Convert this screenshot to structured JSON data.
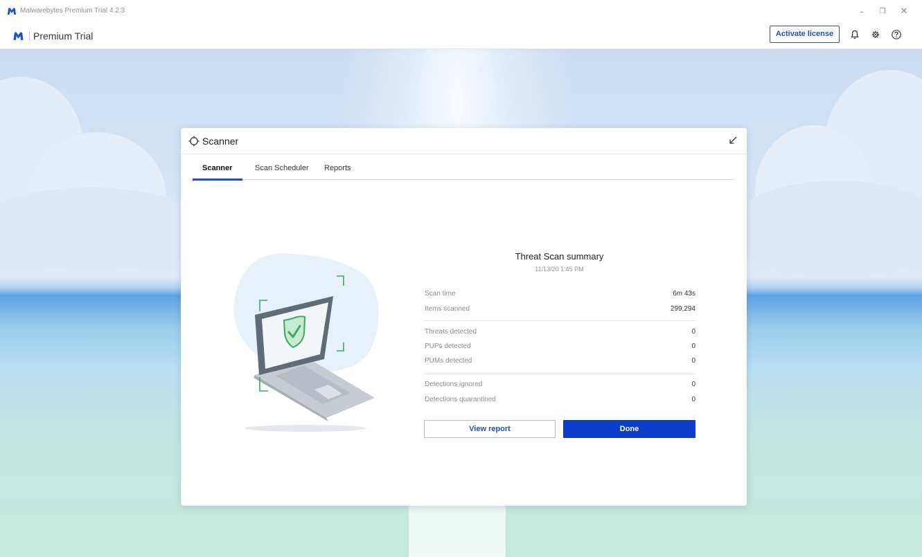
{
  "window": {
    "title": "Malwarebytes Premium Trial  4.2.3",
    "controls": [
      "minimize",
      "maximize",
      "close"
    ]
  },
  "header": {
    "brand_name": "Premium Trial",
    "activate_label": "Activate license",
    "icons": [
      "bell-icon",
      "gear-icon",
      "help-icon"
    ]
  },
  "card": {
    "title": "Scanner",
    "tabs": [
      {
        "label": "Scanner",
        "active": true
      },
      {
        "label": "Scan Scheduler",
        "active": false
      },
      {
        "label": "Reports",
        "active": false
      }
    ]
  },
  "summary": {
    "title": "Threat Scan summary",
    "date": "11/13/20 1:45 PM",
    "stats": [
      {
        "label": "Scan time",
        "value": "6m 43s"
      },
      {
        "label": "Items scanned",
        "value": "299,294"
      },
      {
        "label": "Threats detected",
        "value": "0"
      },
      {
        "label": "PUPs detected",
        "value": "0"
      },
      {
        "label": "PUMs detected",
        "value": "0"
      },
      {
        "label": "Detections ignored",
        "value": "0"
      },
      {
        "label": "Detections quarantined",
        "value": "0"
      }
    ],
    "view_report_label": "View report",
    "done_label": "Done"
  },
  "colors": {
    "accent": "#1f4fc1",
    "done_button": "#0d3ec9",
    "check_green": "#3aaa5c"
  }
}
